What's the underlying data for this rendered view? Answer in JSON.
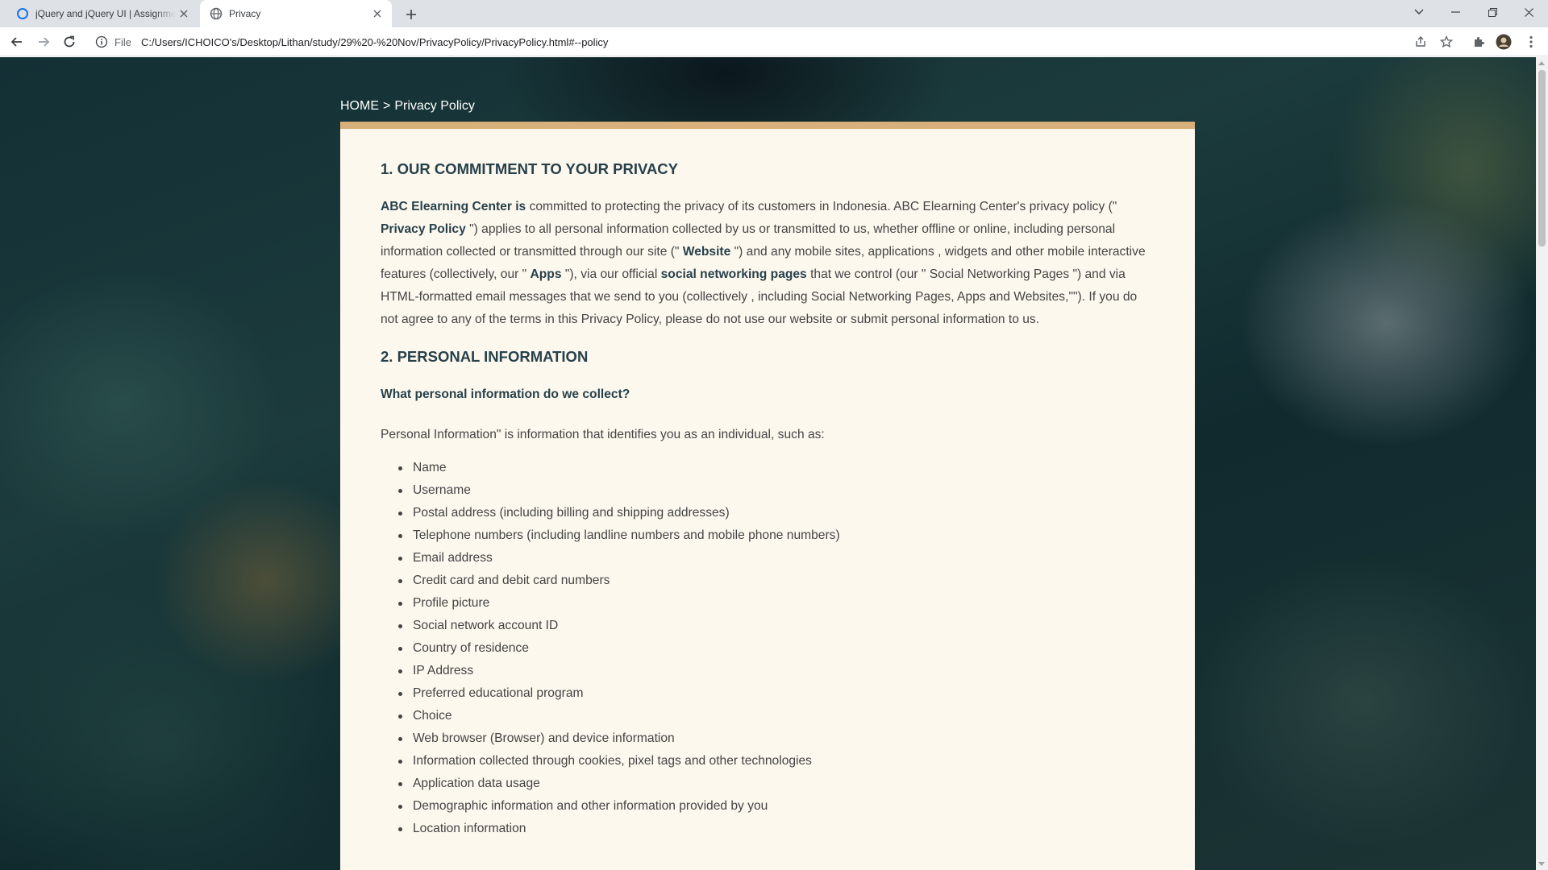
{
  "browser": {
    "tabs": [
      {
        "title": "jQuery and jQuery UI | Assignment",
        "icon": "circle-o-icon",
        "active": false
      },
      {
        "title": "Privacy",
        "icon": "globe-icon",
        "active": true
      }
    ],
    "address": {
      "scheme": "File",
      "url": "C:/Users/ICHOICO's/Desktop/Lithan/study/29%20-%20Nov/PrivacyPolicy/PrivacyPolicy.html#--policy"
    }
  },
  "page": {
    "breadcrumb": {
      "home": "HOME",
      "separator": ">",
      "current": "Privacy Policy"
    },
    "section1": {
      "heading": "1. OUR COMMITMENT TO YOUR PRIVACY",
      "parts": [
        "ABC Elearning Center is",
        " committed to protecting the privacy of its customers in Indonesia. ABC Elearning Center's privacy policy (\" ",
        "Privacy Policy",
        " \") applies to all personal information collected by us or transmitted to us, whether offline or online, including personal information collected or transmitted through our site (\" ",
        "Website",
        " \") and any mobile sites, applications , widgets and other mobile interactive features (collectively, our \" ",
        "Apps",
        " \"), via our official ",
        "social networking pages",
        " that we control (our \" Social Networking Pages \") and via HTML-formatted email messages that we send to you (collectively , including Social Networking Pages, Apps and Websites,\"\"). If you do not agree to any of the terms in this Privacy Policy, please do not use our website or submit personal information to us."
      ]
    },
    "section2": {
      "heading": "2. PERSONAL INFORMATION",
      "subheading": "What personal information do we collect?",
      "intro": "Personal Information\" is information that identifies you as an individual, such as:",
      "items": [
        "Name",
        "Username",
        "Postal address (including billing and shipping addresses)",
        "Telephone numbers (including landline numbers and mobile phone numbers)",
        "Email address",
        "Credit card and debit card numbers",
        "Profile picture",
        "Social network account ID",
        "Country of residence",
        "IP Address",
        "Preferred educational program",
        "Choice",
        "Web browser (Browser) and device information",
        "Information collected through cookies, pixel tags and other technologies",
        "Application data usage",
        "Demographic information and other information provided by you",
        "Location information"
      ]
    }
  },
  "colors": {
    "accent": "#dab07a",
    "heading": "#27414b",
    "card_bg": "#fdf8ee"
  }
}
